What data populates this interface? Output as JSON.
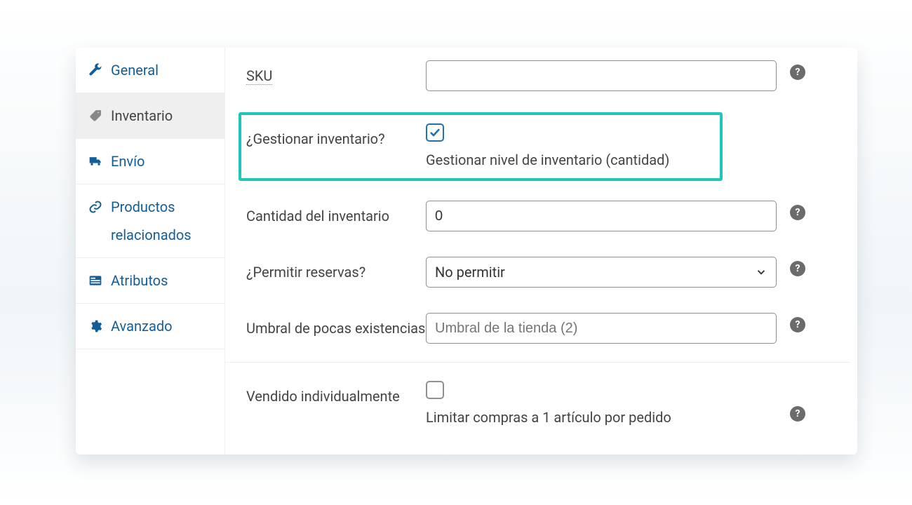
{
  "sidebar": {
    "tabs": [
      {
        "label": "General"
      },
      {
        "label": "Inventario"
      },
      {
        "label": "Envío"
      },
      {
        "label": "Productos",
        "label2": "relacionados"
      },
      {
        "label": "Atributos"
      },
      {
        "label": "Avanzado"
      }
    ]
  },
  "form": {
    "sku_label": "SKU",
    "sku_value": "",
    "manage_label": "¿Gestionar inventario?",
    "manage_sub": "Gestionar nivel de inventario (cantidad)",
    "qty_label": "Cantidad del inventario",
    "qty_value": "0",
    "back_label": "¿Permitir reservas?",
    "back_value": "No permitir",
    "low_label": "Umbral de pocas existencias",
    "low_placeholder": "Umbral de la tienda (2)",
    "sold_label": "Vendido individualmente",
    "sold_sub": "Limitar compras a 1 artículo por pedido"
  }
}
